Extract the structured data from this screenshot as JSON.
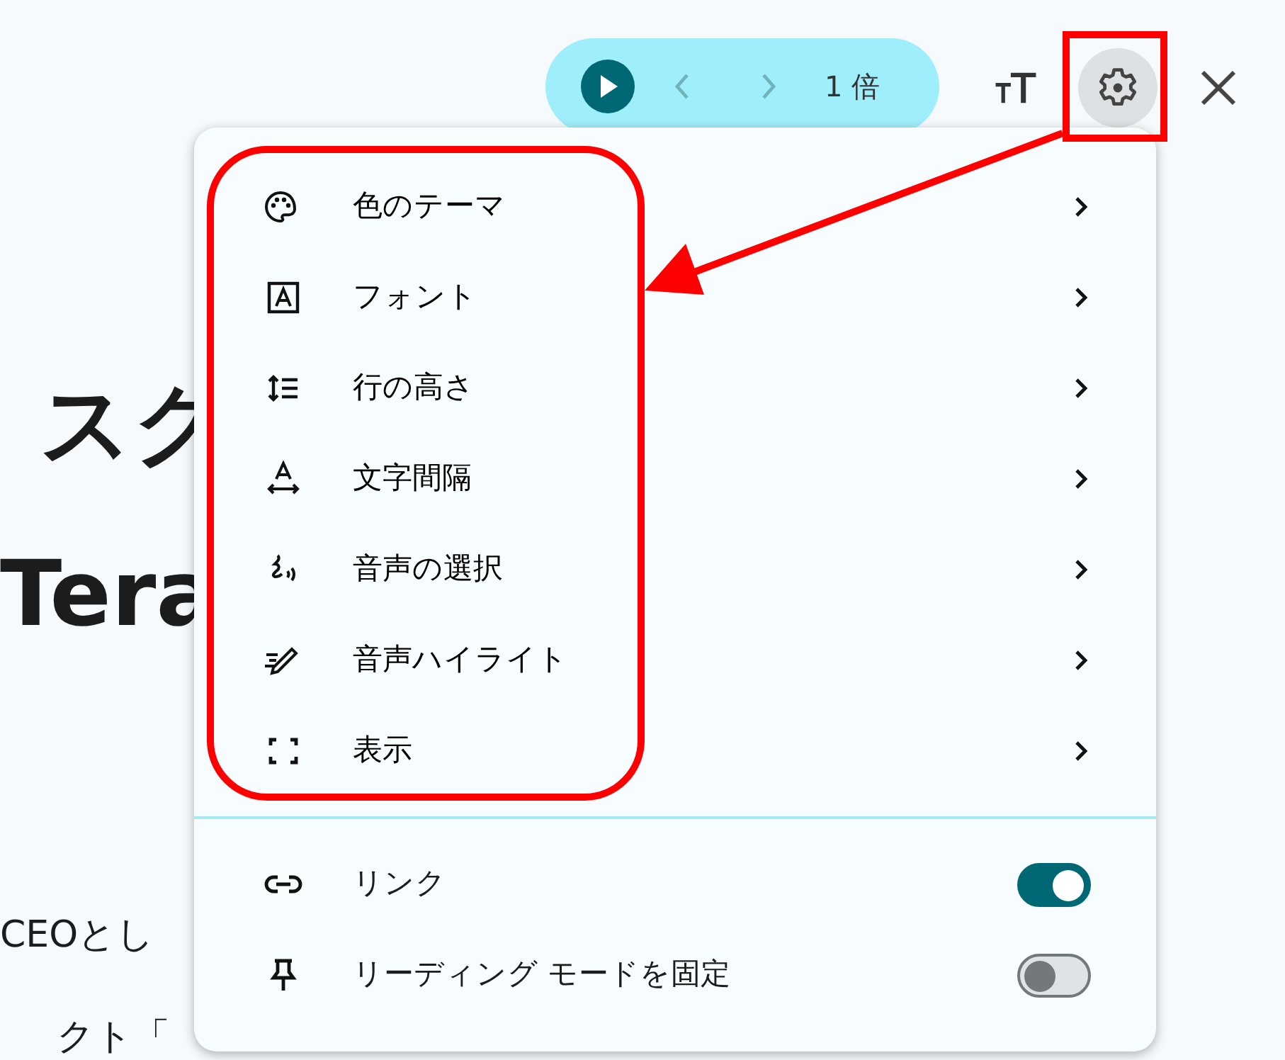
{
  "article": {
    "heading_lines": [
      "スク",
      "Tera"
    ],
    "paragraph_lines": [
      "CEOとし",
      "クト「"
    ]
  },
  "toolbar": {
    "play": {
      "playing": false
    },
    "speed": "1 倍",
    "settings_open": true
  },
  "menu": {
    "items": [
      {
        "label": "色のテーマ",
        "kind": "submenu"
      },
      {
        "label": "フォント",
        "kind": "submenu"
      },
      {
        "label": "行の高さ",
        "kind": "submenu"
      },
      {
        "label": "文字間隔",
        "kind": "submenu"
      },
      {
        "label": "音声の選択",
        "kind": "submenu"
      },
      {
        "label": "音声ハイライト",
        "kind": "submenu"
      },
      {
        "label": "表示",
        "kind": "submenu"
      }
    ],
    "toggles": [
      {
        "label": "リンク",
        "on": true
      },
      {
        "label": "リーディング モードを固定",
        "on": false
      }
    ]
  },
  "annotations": [
    {
      "kind": "gear-frame"
    },
    {
      "kind": "menu-frame"
    },
    {
      "kind": "arrow"
    }
  ]
}
